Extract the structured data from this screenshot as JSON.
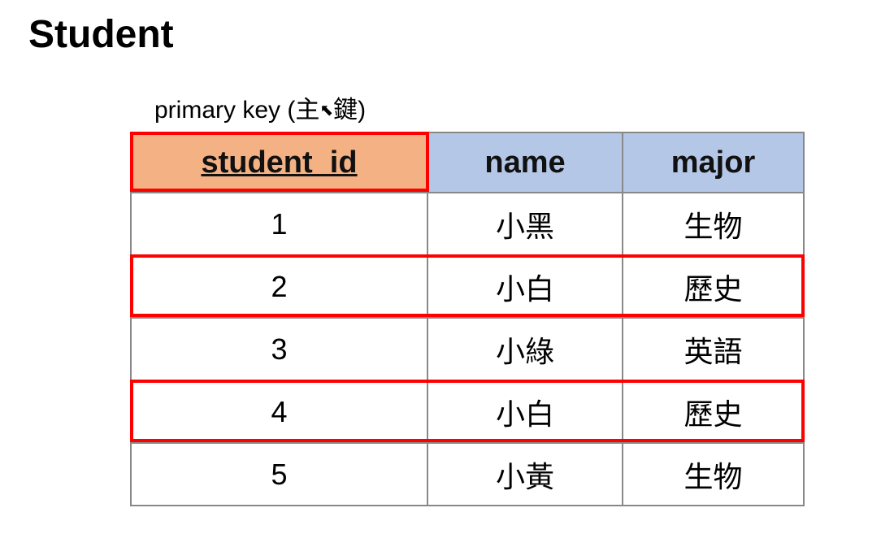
{
  "title": "Student",
  "pk_label_prefix": "primary key (主",
  "pk_label_suffix": "鍵)",
  "cursor_char": "⬉",
  "headers": {
    "student_id": "student_id",
    "name": "name",
    "major": "major"
  },
  "rows": [
    {
      "id": "1",
      "name": "小黑",
      "major": "生物"
    },
    {
      "id": "2",
      "name": "小白",
      "major": "歷史"
    },
    {
      "id": "3",
      "name": "小綠",
      "major": "英語"
    },
    {
      "id": "4",
      "name": "小白",
      "major": "歷史"
    },
    {
      "id": "5",
      "name": "小黃",
      "major": "生物"
    }
  ]
}
